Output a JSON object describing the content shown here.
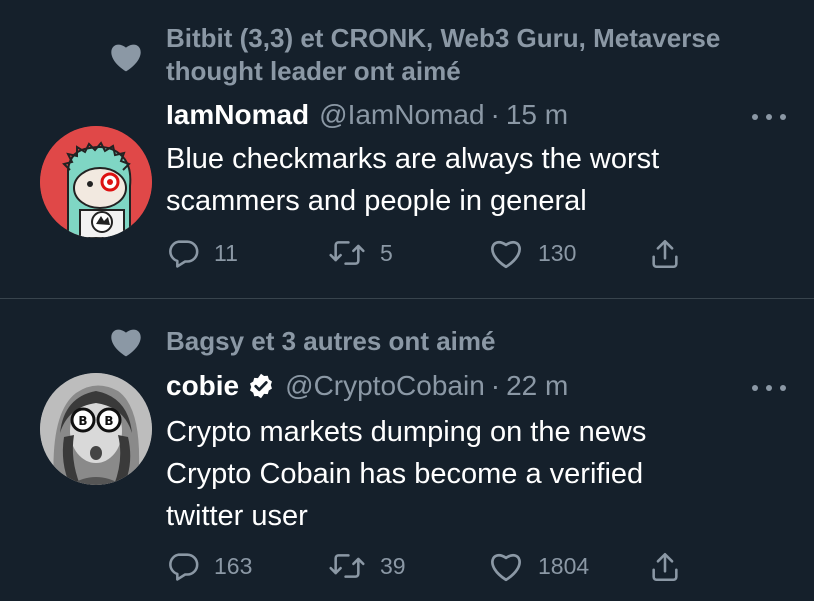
{
  "tweets": [
    {
      "social_context": "Bitbit (3,3) et CRONK, Web3 Guru, Metaverse thought leader ont aimé",
      "name": "IamNomad",
      "handle": "@IamNomad",
      "dot": "·",
      "time": "15 m",
      "verified": false,
      "text_lines": [
        "Blue checkmarks are always the worst",
        "scammers and people in general"
      ],
      "replies": "11",
      "retweets": "5",
      "likes": "130"
    },
    {
      "social_context": "Bagsy et 3 autres ont aimé",
      "name": "cobie",
      "handle": "@CryptoCobain",
      "dot": "·",
      "time": "22 m",
      "verified": true,
      "text_lines": [
        "Crypto markets dumping on the news",
        "Crypto Cobain has become a verified",
        "twitter user"
      ],
      "replies": "163",
      "retweets": "39",
      "likes": "1804"
    }
  ],
  "colors": {
    "background": "#15202b",
    "secondary_text": "#8b98a5",
    "divider": "#38444d",
    "avatar_1_bg": "#e04848"
  },
  "icons": {
    "social_context": "heart-filled-icon",
    "reply": "comment-bubble-icon",
    "retweet": "retweet-arrows-icon",
    "like": "heart-outline-icon",
    "share": "share-upload-icon",
    "more": "more-dots-icon",
    "verified": "verified-badge-icon"
  }
}
